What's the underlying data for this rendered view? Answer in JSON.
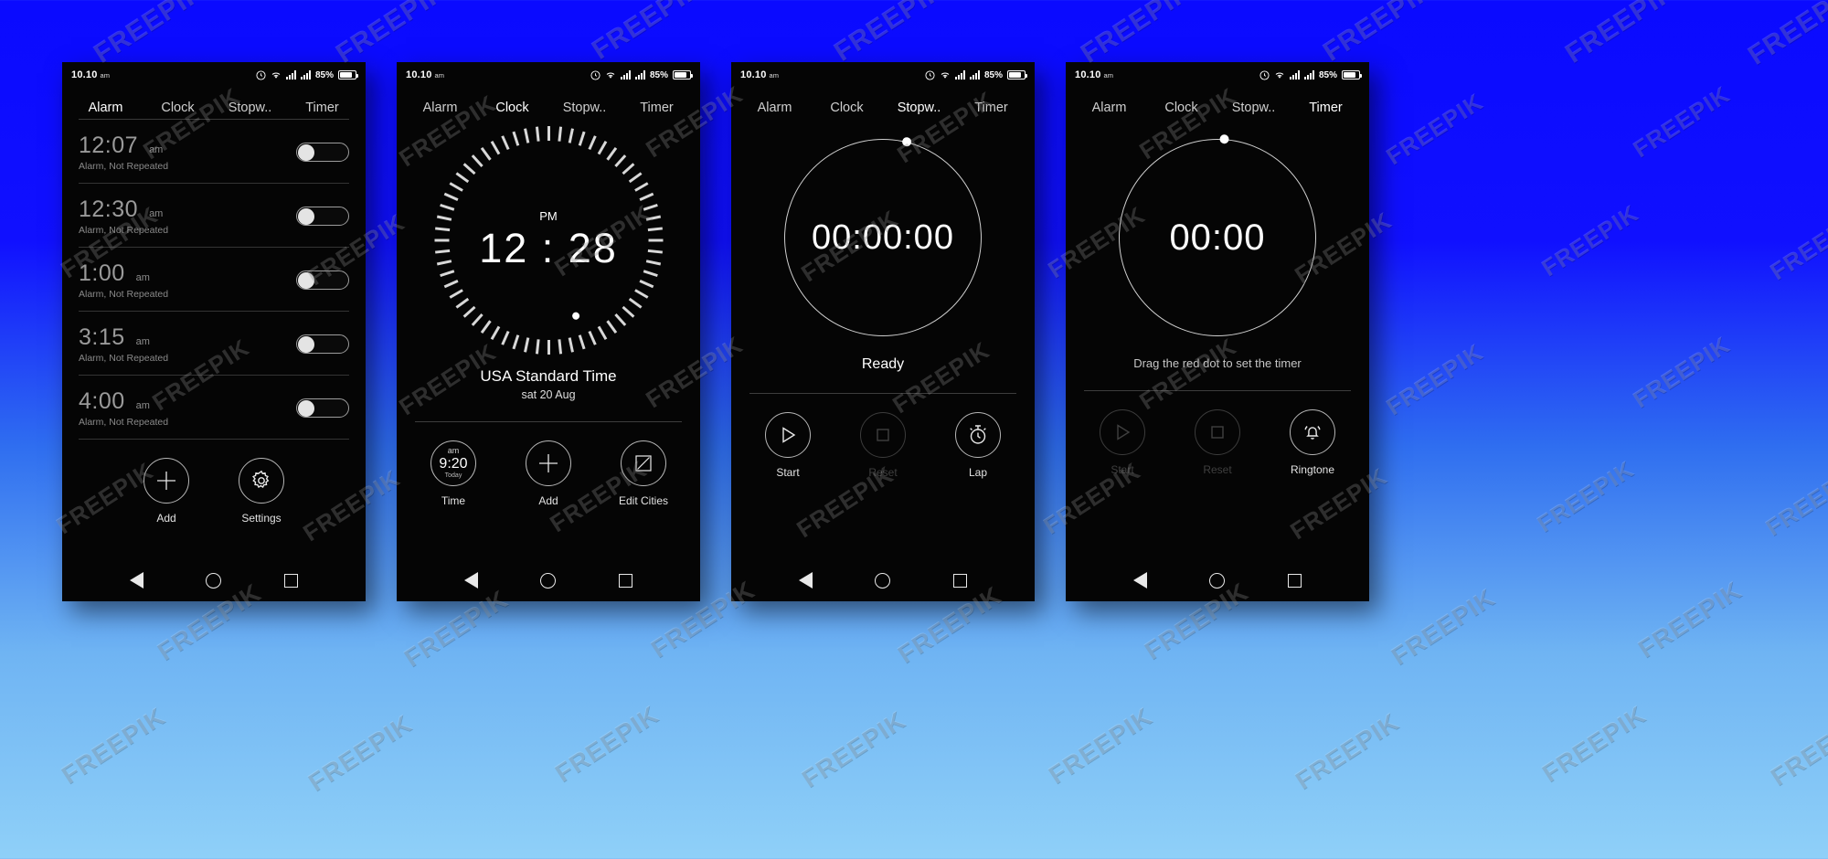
{
  "statusbar": {
    "time": "10.10",
    "ampm": "am",
    "battery_pct": "85%",
    "icons": [
      "alarm-clock-icon",
      "wifi-icon",
      "signal-icon",
      "signal-icon",
      "battery-icon"
    ]
  },
  "tabs": [
    "Alarm",
    "Clock",
    "Stopw..",
    "Timer"
  ],
  "screens": [
    {
      "id": "alarm",
      "active_tab": 0,
      "alarms": [
        {
          "time": "12:07",
          "ampm": "am",
          "sub": "Alarm, Not Repeated",
          "enabled": false
        },
        {
          "time": "12:30",
          "ampm": "am",
          "sub": "Alarm, Not Repeated",
          "enabled": false
        },
        {
          "time": "1:00",
          "ampm": "am",
          "sub": "Alarm, Not Repeated",
          "enabled": false
        },
        {
          "time": "3:15",
          "ampm": "am",
          "sub": "Alarm, Not Repeated",
          "enabled": false
        },
        {
          "time": "4:00",
          "ampm": "am",
          "sub": "Alarm, Not Repeated",
          "enabled": false
        }
      ],
      "actions": [
        {
          "label": "Add",
          "icon": "plus-icon",
          "dim": false
        },
        {
          "label": "Settings",
          "icon": "gear-icon",
          "dim": false
        }
      ]
    },
    {
      "id": "clock",
      "active_tab": 1,
      "clock": {
        "ampm": "PM",
        "time": "12 : 28",
        "zone": "USA Standard Time",
        "date": "sat 20 Aug"
      },
      "time_chip": {
        "ampm": "am",
        "time": "9:20",
        "day": "Today"
      },
      "actions": [
        {
          "label": "Time",
          "icon": "time-chip-icon",
          "dim": false
        },
        {
          "label": "Add",
          "icon": "plus-icon",
          "dim": false
        },
        {
          "label": "Edit Cities",
          "icon": "edit-square-icon",
          "dim": false
        }
      ]
    },
    {
      "id": "stopwatch",
      "active_tab": 2,
      "stopwatch": {
        "value": "00:00:00",
        "status": "Ready"
      },
      "actions": [
        {
          "label": "Start",
          "icon": "play-icon",
          "dim": false
        },
        {
          "label": "Reset",
          "icon": "stop-square-icon",
          "dim": true
        },
        {
          "label": "Lap",
          "icon": "stopwatch-icon",
          "dim": true
        }
      ]
    },
    {
      "id": "timer",
      "active_tab": 3,
      "timer": {
        "value": "00:00",
        "hint": "Drag the red dot to set the timer"
      },
      "actions": [
        {
          "label": "Start",
          "icon": "play-icon",
          "dim": true
        },
        {
          "label": "Reset",
          "icon": "stop-square-icon",
          "dim": true
        },
        {
          "label": "Ringtone",
          "icon": "bell-ring-icon",
          "dim": false
        }
      ]
    }
  ],
  "navbar": {
    "back": "back-triangle-icon",
    "home": "home-circle-icon",
    "recent": "recent-square-icon"
  },
  "watermark": {
    "text": "FREEPIK"
  },
  "colors": {
    "background_top": "#0a0aff",
    "background_bottom": "#8fd0f8",
    "screen_bg": "#050505",
    "text_primary": "#ffffff",
    "text_dim": "#8e8e8e",
    "text_disabled": "#3f3f3f",
    "rule": "#343434"
  }
}
